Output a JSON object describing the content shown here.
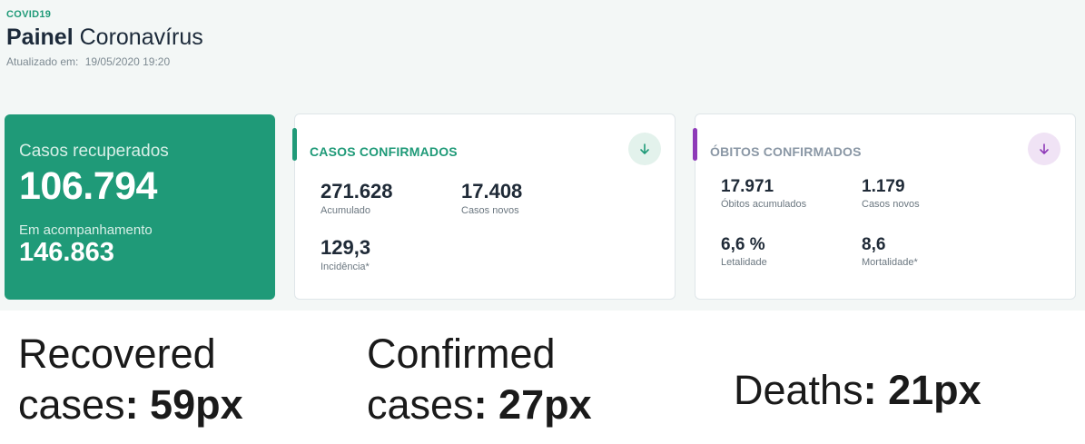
{
  "header": {
    "kicker": "COVID19",
    "title_strong": "Painel",
    "title_light": "Coronavírus",
    "updated_label": "Atualizado em:",
    "updated_value": "19/05/2020 19:20"
  },
  "recovered": {
    "label": "Casos recuperados",
    "value": "106.794",
    "followup_label": "Em acompanhamento",
    "followup_value": "146.863"
  },
  "confirmed": {
    "title": "CASOS CONFIRMADOS",
    "expand_icon": "arrow-down-icon",
    "stats": [
      {
        "value": "271.628",
        "caption": "Acumulado"
      },
      {
        "value": "17.408",
        "caption": "Casos novos"
      },
      {
        "value": "129,3",
        "caption": "Incidência*"
      }
    ]
  },
  "deaths": {
    "title": "ÓBITOS CONFIRMADOS",
    "expand_icon": "arrow-down-icon",
    "stats": [
      {
        "value": "17.971",
        "caption": "Óbitos acumulados"
      },
      {
        "value": "1.179",
        "caption": "Casos novos"
      },
      {
        "value": "6,6 %",
        "caption": "Letalidade"
      },
      {
        "value": "8,6",
        "caption": "Mortalidade*"
      }
    ]
  },
  "annotations": {
    "recovered_line1": "Recovered",
    "recovered_line2": "cases",
    "recovered_value": ": 59px",
    "confirmed_line1": "Confirmed",
    "confirmed_line2": "cases",
    "confirmed_value": ": 27px",
    "deaths_label": "Deaths",
    "deaths_value": ": 21px"
  },
  "colors": {
    "accent_green": "#1f9a78",
    "accent_purple": "#8e3ab8",
    "background": "#f3f7f6"
  }
}
